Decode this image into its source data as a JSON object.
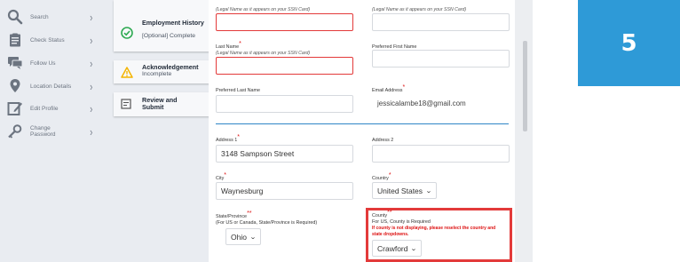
{
  "nav": {
    "items": [
      {
        "label": "Search",
        "icon": "search-icon"
      },
      {
        "label": "Check Status",
        "icon": "clipboard-icon"
      },
      {
        "label": "Follow Us",
        "icon": "chat-icon"
      },
      {
        "label": "Location Details",
        "icon": "location-pin-icon"
      },
      {
        "label": "Edit Profile",
        "icon": "edit-icon"
      },
      {
        "label": "Change Password",
        "icon": "key-icon"
      }
    ],
    "chevron": "›"
  },
  "steps": [
    {
      "title": "Employment History",
      "status": "[Optional] Complete",
      "icon": "check-circle-icon",
      "color": "#2eaa52"
    },
    {
      "title": "Acknowledgement",
      "status": "Incomplete",
      "icon": "warning-icon",
      "color": "#f4b400"
    },
    {
      "title": "Review and Submit",
      "status": "",
      "icon": "review-document-icon"
    }
  ],
  "form": {
    "legal_note": "(Legal Name as it appears on your SSN Card)",
    "last_name": {
      "label": "Last Name",
      "note": "(Legal Name as it appears on your SSN Card)",
      "value": ""
    },
    "preferred_first": {
      "label": "Preferred First Name",
      "value": ""
    },
    "preferred_last": {
      "label": "Preferred Last Name",
      "value": ""
    },
    "email": {
      "label": "Email Address",
      "value": "jessicalambe18@gmail.com"
    },
    "address1": {
      "label": "Address 1",
      "value": "3148 Sampson Street"
    },
    "address2": {
      "label": "Address 2",
      "value": ""
    },
    "city": {
      "label": "City",
      "value": "Waynesburg"
    },
    "country": {
      "label": "Country",
      "value": "United States"
    },
    "state": {
      "label": "State/Province",
      "note": "(For US or Canada, State/Province is Required)",
      "value": "Ohio"
    },
    "county": {
      "label": "County",
      "note": "For US, County is Required",
      "warning_line1": "If county is not displaying, please reselect the country and",
      "warning_line2": "state dropdowns.",
      "value": "Crawford"
    },
    "required_mark": "*",
    "required_mark_double": "**",
    "caret": "⌄"
  },
  "step_number": "5",
  "colors": {
    "accent": "#2e9ad7",
    "error": "#e33a3a",
    "divider": "#2f86c7"
  }
}
